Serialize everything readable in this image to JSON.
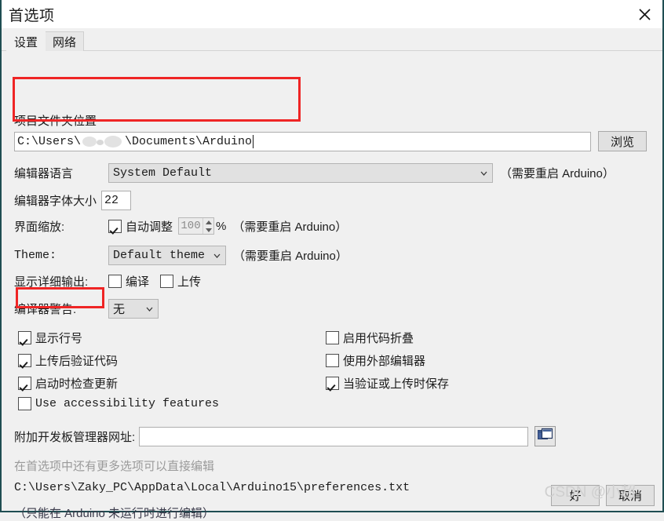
{
  "window": {
    "title": "首选项",
    "close_icon": "close-icon"
  },
  "tabs": [
    {
      "label": "设置",
      "active": true
    },
    {
      "label": "网络",
      "active": false
    }
  ],
  "settings": {
    "sketchbook": {
      "label": "项目文件夹位置",
      "value_prefix": "C:\\Users\\",
      "value_suffix": "\\Documents\\Arduino",
      "redacted": true,
      "browse_label": "浏览"
    },
    "editor_language": {
      "label": "编辑器语言",
      "value": "System Default",
      "restart_hint": "（需要重启 Arduino）"
    },
    "editor_font_size": {
      "label": "编辑器字体大小",
      "value": "22"
    },
    "interface_scale": {
      "label": "界面缩放:",
      "auto_label": "自动调整",
      "auto_checked": true,
      "value": "100",
      "unit": "%",
      "restart_hint": "（需要重启 Arduino）"
    },
    "theme": {
      "label": "Theme:",
      "value": "Default theme",
      "restart_hint": "（需要重启 Arduino）"
    },
    "verbose_output": {
      "label": "显示详细输出:",
      "compile_label": "编译",
      "compile_checked": false,
      "upload_label": "上传",
      "upload_checked": false
    },
    "compiler_warnings": {
      "label": "编译器警告:",
      "value": "无"
    },
    "checkboxes_left": [
      {
        "label": "显示行号",
        "checked": true,
        "mono": false
      },
      {
        "label": "上传后验证代码",
        "checked": true,
        "mono": false
      },
      {
        "label": "启动时检查更新",
        "checked": true,
        "mono": false
      },
      {
        "label": "Use accessibility features",
        "checked": false,
        "mono": true
      }
    ],
    "checkboxes_right": [
      {
        "label": "启用代码折叠",
        "checked": false
      },
      {
        "label": "使用外部编辑器",
        "checked": false
      },
      {
        "label": "当验证或上传时保存",
        "checked": true
      }
    ],
    "board_urls": {
      "label": "附加开发板管理器网址:",
      "value": "",
      "placeholder": "",
      "expand_icon": "cascade-windows-icon"
    },
    "footer": {
      "more_prefs": "在首选项中还有更多选项可以直接编辑",
      "prefs_path": "C:\\Users\\Zaky_PC\\AppData\\Local\\Arduino15\\preferences.txt",
      "edit_note": "（只能在 Arduino 未运行时进行编辑）"
    }
  },
  "buttons": {
    "ok": "好",
    "cancel": "取消"
  },
  "watermark": "CSDN @小超",
  "colors": {
    "window_bg": "#f0f0f0",
    "titlebar_bg": "#ffffff",
    "annotation_red": "#ef2525",
    "border_teal": "#1f4e52",
    "field_bg": "#ffffff",
    "disabled_text": "#8b8b8b",
    "grey_text": "#9a9a9a"
  }
}
